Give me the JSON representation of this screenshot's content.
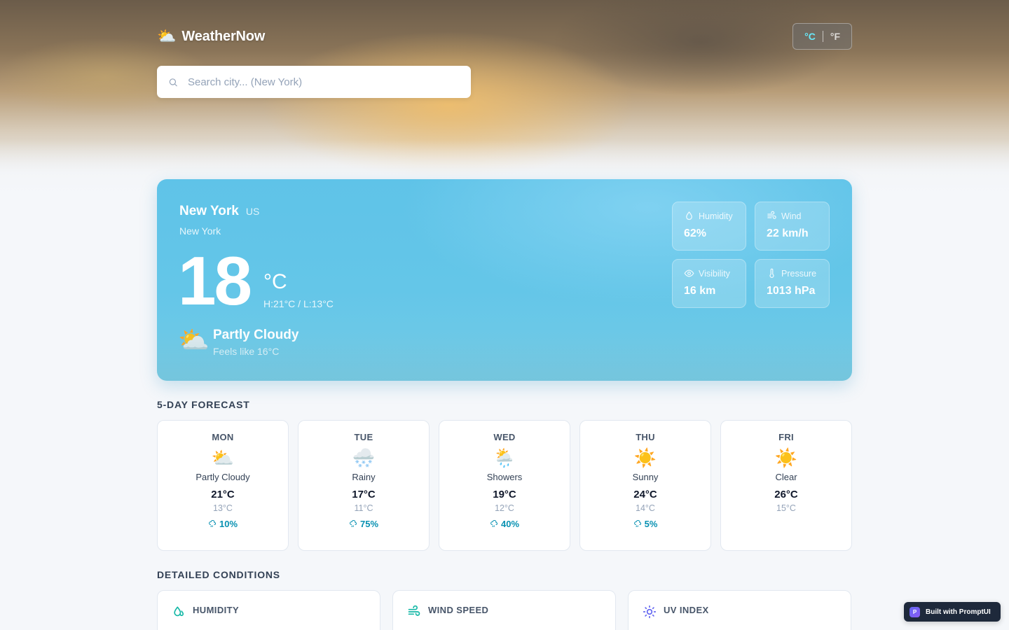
{
  "app": {
    "name": "WeatherNow",
    "logo_icon": "⛅"
  },
  "units": {
    "celsius": "°C",
    "fahrenheit": "°F",
    "active": "celsius"
  },
  "search": {
    "placeholder": "Search city... (New York)",
    "value": ""
  },
  "current": {
    "city": "New York",
    "country": "US",
    "region": "New York",
    "temperature": "18",
    "unit": "°C",
    "hi_lo": "H:21°C / L:13°C",
    "condition_icon": "⛅",
    "condition": "Partly Cloudy",
    "feels_like": "Feels like 16°C",
    "stats": [
      {
        "label": "Humidity",
        "value": "62%",
        "icon": "droplet-icon"
      },
      {
        "label": "Wind",
        "value": "22 km/h",
        "icon": "wind-icon"
      },
      {
        "label": "Visibility",
        "value": "16 km",
        "icon": "eye-icon"
      },
      {
        "label": "Pressure",
        "value": "1013 hPa",
        "icon": "thermometer-icon"
      }
    ]
  },
  "forecast": {
    "title": "5-DAY FORECAST",
    "days": [
      {
        "day": "MON",
        "icon": "⛅",
        "condition": "Partly Cloudy",
        "high": "21°C",
        "low": "13°C",
        "rain": "10%"
      },
      {
        "day": "TUE",
        "icon": "🌨️",
        "condition": "Rainy",
        "high": "17°C",
        "low": "11°C",
        "rain": "75%"
      },
      {
        "day": "WED",
        "icon": "🌦️",
        "condition": "Showers",
        "high": "19°C",
        "low": "12°C",
        "rain": "40%"
      },
      {
        "day": "THU",
        "icon": "☀️",
        "condition": "Sunny",
        "high": "24°C",
        "low": "14°C",
        "rain": "5%"
      },
      {
        "day": "FRI",
        "icon": "☀️",
        "condition": "Clear",
        "high": "26°C",
        "low": "15°C",
        "rain": ""
      }
    ]
  },
  "details": {
    "title": "DETAILED CONDITIONS",
    "cards": [
      {
        "title": "HUMIDITY",
        "icon": "droplet-icon",
        "color": "#14b8a6"
      },
      {
        "title": "WIND SPEED",
        "icon": "wind-icon",
        "color": "#14b8a6"
      },
      {
        "title": "UV INDEX",
        "icon": "sun-icon",
        "color": "#6366f1"
      }
    ]
  },
  "promo": {
    "badge": "P",
    "text": "Built with PromptUI"
  }
}
